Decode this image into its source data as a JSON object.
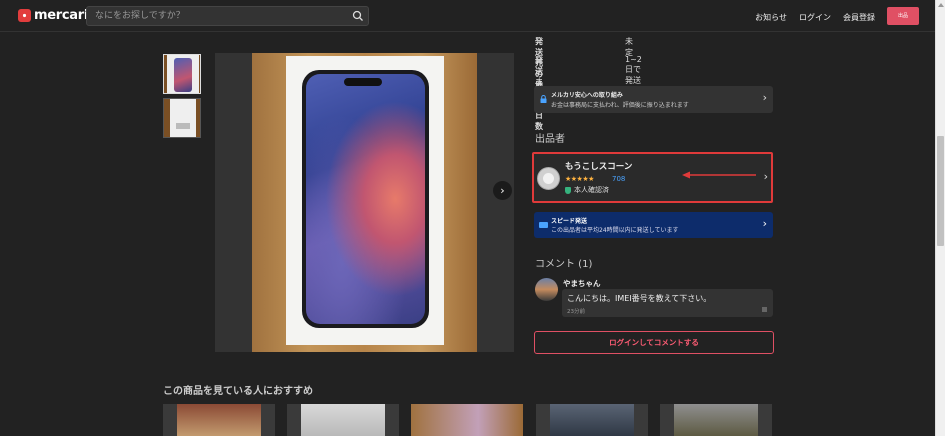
{
  "header": {
    "logo_text": "mercari",
    "search_placeholder": "なにをお探しですか？",
    "nav": {
      "notifications": "お知らせ",
      "login": "ログイン",
      "signup": "会員登録",
      "sell": "出品"
    }
  },
  "product": {
    "thumbnails": [
      "thumbnail-1",
      "thumbnail-2"
    ],
    "shipping": [
      {
        "label": "発送元の地域",
        "value": "未定"
      },
      {
        "label": "発送までの日数",
        "value": "1~2日で発送"
      }
    ],
    "safety": {
      "title": "メルカリ安心への取り組み",
      "desc": "お金は事務局に支払われ、評価後に振り込まれます"
    }
  },
  "seller": {
    "section_title": "出品者",
    "name": "もうこしスコーン",
    "stars": "★★★★★",
    "rating_count": "708",
    "verified": "本人確認済"
  },
  "speed": {
    "title": "スピード発送",
    "desc": "この出品者は平均24時間以内に発送しています"
  },
  "comments": {
    "title": "コメント (1)",
    "items": [
      {
        "name": "やまちゃん",
        "text": "こんにちは。IMEI番号を教えて下さい。",
        "time": "23分前"
      }
    ],
    "login_button": "ログインしてコメントする"
  },
  "recommend": {
    "title": "この商品を見ている人におすすめ"
  },
  "colors": {
    "accent": "#e05064",
    "highlight_border": "#e03a3a",
    "rating_blue": "#4aa3ff",
    "star": "#ffb340",
    "speed_bg": "#0d2c6b"
  }
}
